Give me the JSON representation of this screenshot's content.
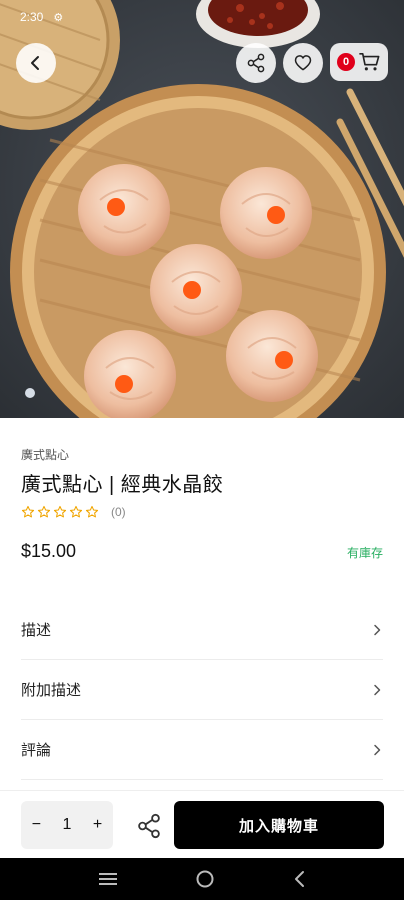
{
  "status_bar": {
    "time": "2:30",
    "settings_icon": "gear-icon"
  },
  "header": {
    "back_icon": "chevron-left-icon",
    "share_icon": "share-icon",
    "favorite_icon": "heart-icon",
    "cart_icon": "cart-icon",
    "cart_count": "0"
  },
  "product": {
    "category": "廣式點心",
    "title": "廣式點心 | 經典水晶餃",
    "rating": 0,
    "review_count": "(0)",
    "price": "$15.00",
    "stock_status": "有庫存"
  },
  "accordion": [
    {
      "label": "描述"
    },
    {
      "label": "附加描述"
    },
    {
      "label": "評論"
    }
  ],
  "bottom_bar": {
    "qty_minus": "−",
    "quantity": "1",
    "qty_plus": "+",
    "add_to_cart": "加入購物車"
  },
  "colors": {
    "accent": "#000000",
    "stock_green": "#27ae60",
    "badge_red": "#e0001b",
    "star": "#f0a500"
  }
}
